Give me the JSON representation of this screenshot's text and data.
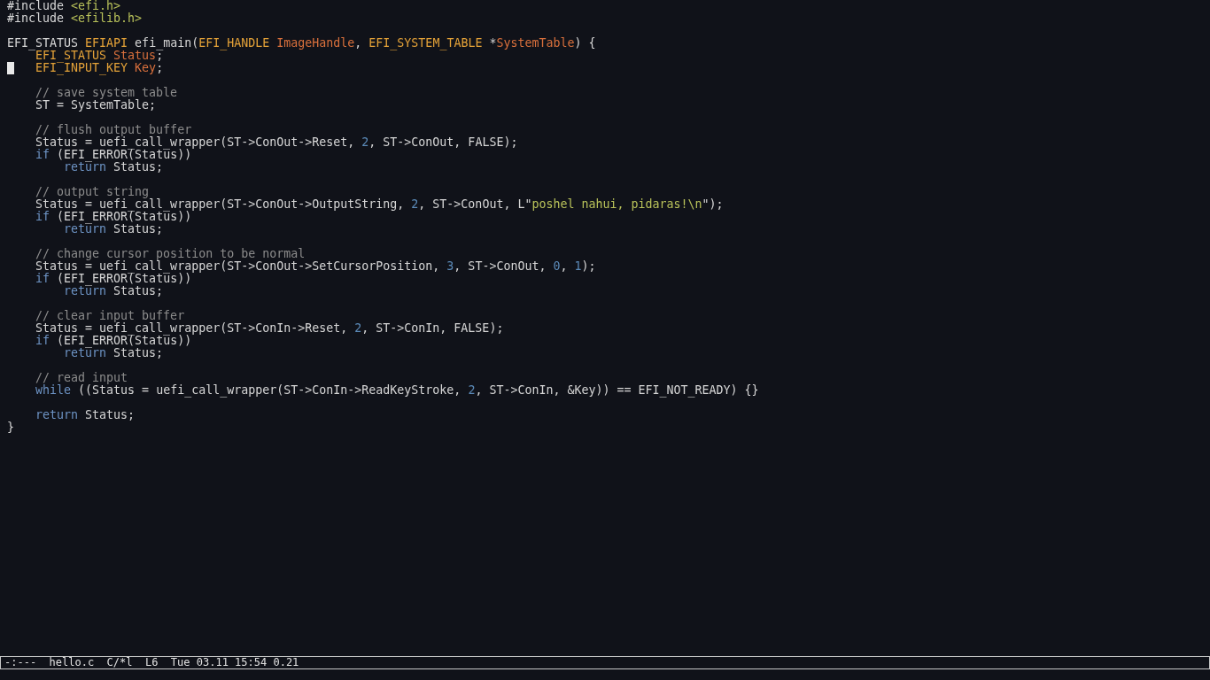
{
  "editor": {
    "lines": [
      {
        "cursor": false,
        "tokens": [
          {
            "kind": "plain",
            "text": "#include "
          },
          {
            "kind": "string",
            "text": "<efi.h>"
          }
        ]
      },
      {
        "cursor": false,
        "tokens": [
          {
            "kind": "plain",
            "text": "#include "
          },
          {
            "kind": "string",
            "text": "<efilib.h>"
          }
        ]
      },
      {
        "cursor": false
      },
      {
        "cursor": false,
        "tokens": [
          {
            "kind": "plain",
            "text": "EFI_STATUS "
          },
          {
            "kind": "type",
            "text": "EFIAPI"
          },
          {
            "kind": "plain",
            "text": " efi_main("
          },
          {
            "kind": "type",
            "text": "EFI_HANDLE"
          },
          {
            "kind": "param",
            "text": " ImageHandle"
          },
          {
            "kind": "plain",
            "text": ", "
          },
          {
            "kind": "type",
            "text": "EFI_SYSTEM_TABLE"
          },
          {
            "kind": "plain",
            "text": " *"
          },
          {
            "kind": "param",
            "text": "SystemTable"
          },
          {
            "kind": "plain",
            "text": ") {"
          }
        ]
      },
      {
        "cursor": false,
        "tokens": [
          {
            "kind": "type",
            "text": "    EFI_STATUS"
          },
          {
            "kind": "param",
            "text": " Status"
          },
          {
            "kind": "plain",
            "text": ";"
          }
        ]
      },
      {
        "cursor": true,
        "tokens": [
          {
            "kind": "type",
            "text": "    EFI_INPUT_KEY"
          },
          {
            "kind": "param",
            "text": " Key"
          },
          {
            "kind": "plain",
            "text": ";"
          }
        ]
      },
      {
        "cursor": false
      },
      {
        "cursor": false,
        "tokens": [
          {
            "kind": "comment",
            "text": "    // save system table"
          }
        ]
      },
      {
        "cursor": false,
        "tokens": [
          {
            "kind": "plain",
            "text": "    ST = SystemTable;"
          }
        ]
      },
      {
        "cursor": false
      },
      {
        "cursor": false,
        "tokens": [
          {
            "kind": "comment",
            "text": "    // flush output buffer"
          }
        ]
      },
      {
        "cursor": false,
        "tokens": [
          {
            "kind": "plain",
            "text": "    Status = uefi_call_wrapper(ST->ConOut->Reset, "
          },
          {
            "kind": "number",
            "text": "2"
          },
          {
            "kind": "plain",
            "text": ", ST->ConOut, FALSE);"
          }
        ]
      },
      {
        "cursor": false,
        "tokens": [
          {
            "kind": "keyword",
            "text": "    if"
          },
          {
            "kind": "plain",
            "text": " (EFI_ERROR(Status))"
          }
        ]
      },
      {
        "cursor": false,
        "tokens": [
          {
            "kind": "keyword",
            "text": "        return"
          },
          {
            "kind": "plain",
            "text": " Status;"
          }
        ]
      },
      {
        "cursor": false
      },
      {
        "cursor": false,
        "tokens": [
          {
            "kind": "comment",
            "text": "    // output string"
          }
        ]
      },
      {
        "cursor": false,
        "tokens": [
          {
            "kind": "plain",
            "text": "    Status = uefi_call_wrapper(ST->ConOut->OutputString, "
          },
          {
            "kind": "number",
            "text": "2"
          },
          {
            "kind": "plain",
            "text": ", ST->ConOut, L\""
          },
          {
            "kind": "string",
            "text": "poshel nahui, pidaras!\\n"
          },
          {
            "kind": "plain",
            "text": "\");"
          }
        ]
      },
      {
        "cursor": false,
        "tokens": [
          {
            "kind": "keyword",
            "text": "    if"
          },
          {
            "kind": "plain",
            "text": " (EFI_ERROR(Status))"
          }
        ]
      },
      {
        "cursor": false,
        "tokens": [
          {
            "kind": "keyword",
            "text": "        return"
          },
          {
            "kind": "plain",
            "text": " Status;"
          }
        ]
      },
      {
        "cursor": false
      },
      {
        "cursor": false,
        "tokens": [
          {
            "kind": "comment",
            "text": "    // change cursor position to be normal"
          }
        ]
      },
      {
        "cursor": false,
        "tokens": [
          {
            "kind": "plain",
            "text": "    Status = uefi_call_wrapper(ST->ConOut->SetCursorPosition, "
          },
          {
            "kind": "number",
            "text": "3"
          },
          {
            "kind": "plain",
            "text": ", ST->ConOut, "
          },
          {
            "kind": "number",
            "text": "0"
          },
          {
            "kind": "plain",
            "text": ", "
          },
          {
            "kind": "number",
            "text": "1"
          },
          {
            "kind": "plain",
            "text": ");"
          }
        ]
      },
      {
        "cursor": false,
        "tokens": [
          {
            "kind": "keyword",
            "text": "    if"
          },
          {
            "kind": "plain",
            "text": " (EFI_ERROR(Status))"
          }
        ]
      },
      {
        "cursor": false,
        "tokens": [
          {
            "kind": "keyword",
            "text": "        return"
          },
          {
            "kind": "plain",
            "text": " Status;"
          }
        ]
      },
      {
        "cursor": false
      },
      {
        "cursor": false,
        "tokens": [
          {
            "kind": "comment",
            "text": "    // clear input buffer"
          }
        ]
      },
      {
        "cursor": false,
        "tokens": [
          {
            "kind": "plain",
            "text": "    Status = uefi_call_wrapper(ST->ConIn->Reset, "
          },
          {
            "kind": "number",
            "text": "2"
          },
          {
            "kind": "plain",
            "text": ", ST->ConIn, FALSE);"
          }
        ]
      },
      {
        "cursor": false,
        "tokens": [
          {
            "kind": "keyword",
            "text": "    if"
          },
          {
            "kind": "plain",
            "text": " (EFI_ERROR(Status))"
          }
        ]
      },
      {
        "cursor": false,
        "tokens": [
          {
            "kind": "keyword",
            "text": "        return"
          },
          {
            "kind": "plain",
            "text": " Status;"
          }
        ]
      },
      {
        "cursor": false
      },
      {
        "cursor": false,
        "tokens": [
          {
            "kind": "comment",
            "text": "    // read input"
          }
        ]
      },
      {
        "cursor": false,
        "tokens": [
          {
            "kind": "keyword",
            "text": "    while"
          },
          {
            "kind": "plain",
            "text": " ((Status = uefi_call_wrapper(ST->ConIn->ReadKeyStroke, "
          },
          {
            "kind": "number",
            "text": "2"
          },
          {
            "kind": "plain",
            "text": ", ST->ConIn, &Key)) == EFI_NOT_READY) {}"
          }
        ]
      },
      {
        "cursor": false
      },
      {
        "cursor": false,
        "tokens": [
          {
            "kind": "keyword",
            "text": "    return"
          },
          {
            "kind": "plain",
            "text": " Status;"
          }
        ]
      },
      {
        "cursor": false,
        "tokens": [
          {
            "kind": "plain",
            "text": "}"
          }
        ]
      }
    ]
  },
  "status_bar": {
    "text": "-:---  hello.c  C/*l  L6  Tue 03.11 15:54 0.21"
  }
}
